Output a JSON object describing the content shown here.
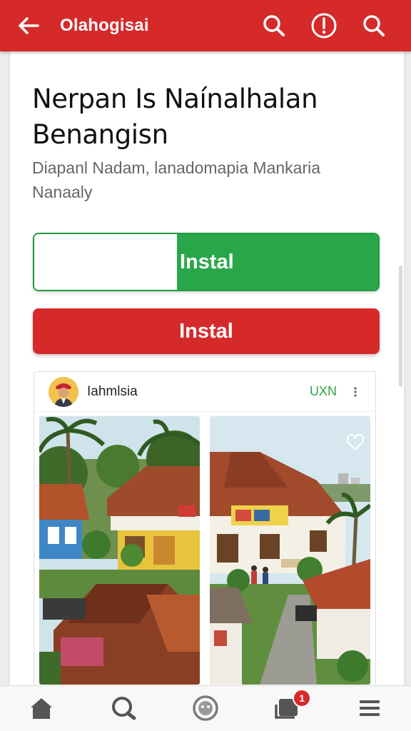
{
  "topbar": {
    "title": "Olahogisai",
    "background": "#d62a2a",
    "icons": [
      "back-arrow-icon",
      "search-icon",
      "info-icon",
      "search-icon"
    ]
  },
  "app": {
    "title_line1": "Nerpan Is Naínalhalan",
    "title_line2": "Benangisn",
    "description_line1": "Diapanl Nadam, lanadomapia Mankaria",
    "description_line2": "Nanaaly"
  },
  "buttons": {
    "install_primary": "Instal",
    "install_secondary": "Instal",
    "green": "#2aa64a",
    "red": "#d62a2a"
  },
  "post": {
    "username": "Iahmlsia",
    "tag": "UXN",
    "more_icon": "more-vertical-icon",
    "photos": [
      "village-houses-photo-left",
      "village-houses-photo-right"
    ]
  },
  "bottom_nav": {
    "items": [
      {
        "icon": "home-icon"
      },
      {
        "icon": "search-icon"
      },
      {
        "icon": "profile-circle-icon"
      },
      {
        "icon": "inbox-icon",
        "badge": "1"
      },
      {
        "icon": "menu-icon"
      }
    ]
  }
}
